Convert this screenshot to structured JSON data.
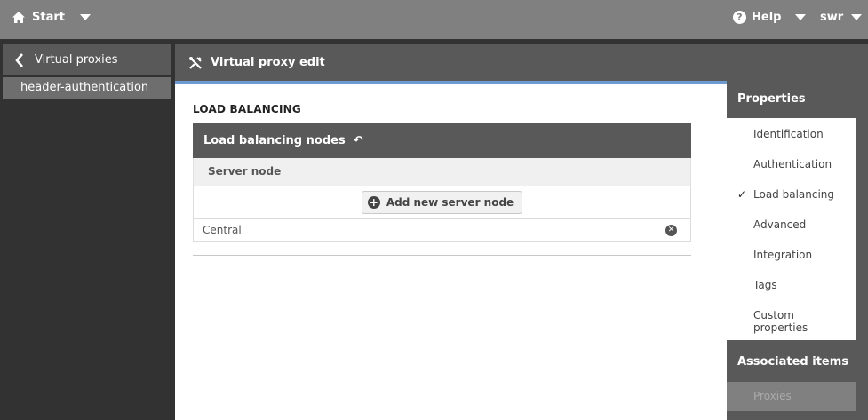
{
  "topbar": {
    "start_label": "Start",
    "help_label": "Help",
    "user_label": "swr"
  },
  "sidebar": {
    "back_label": "Virtual proxies",
    "current_item": "header-authentication"
  },
  "main": {
    "header_title": "Virtual proxy edit",
    "section_title": "LOAD BALANCING",
    "box_title": "Load balancing nodes",
    "column_header": "Server node",
    "add_button_label": "Add new server node",
    "nodes": [
      "Central"
    ]
  },
  "properties": {
    "title": "Properties",
    "items": [
      "Identification",
      "Authentication",
      "Load balancing",
      "Advanced",
      "Integration",
      "Tags",
      "Custom properties"
    ],
    "selected": "Load balancing",
    "associated_title": "Associated items",
    "associated_items": [
      "Proxies"
    ]
  },
  "colors": {
    "topbar": "#808080",
    "header": "#595959",
    "accent_line": "#6d9bd1",
    "background": "#323232"
  }
}
